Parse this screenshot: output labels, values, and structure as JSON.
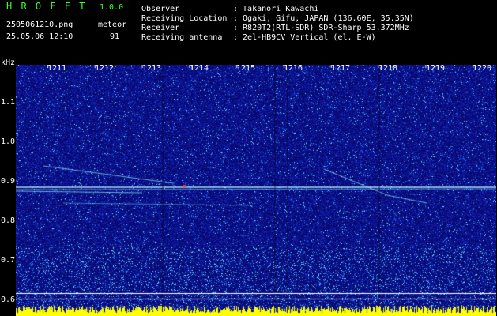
{
  "header": {
    "app_title": "H R O F F T",
    "version": "1.0.0",
    "filename": "2505061210.png",
    "datetime": "25.05.06 12:10",
    "meteor_label": "meteor",
    "meteor_count": "91",
    "observer_label": "Observer",
    "observer_value": ": Takanori Kawachi",
    "location_label": "Receiving Location",
    "location_value": ": Ogaki, Gifu, JAPAN (136.60E, 35.35N)",
    "receiver_label": "Receiver",
    "receiver_value": ": R820T2(RTL-SDR) SDR-Sharp 53.372MHz",
    "antenna_label": "Receiving antenna",
    "antenna_value": ": 2el-HB9CV Vertical (el. E-W)"
  },
  "spectrogram": {
    "y_unit": "kHz",
    "x_ticks": [
      "1211",
      "1212",
      "1213",
      "1214",
      "1215",
      "1216",
      "1217",
      "1218",
      "1219",
      "1220"
    ],
    "y_ticks": [
      "1.1",
      "1.0",
      "0.9",
      "0.8",
      "0.7",
      "0.6"
    ]
  },
  "colors": {
    "background": "#000000",
    "spectrum_base": "#1010a0",
    "title_green": "#33ff33",
    "text": "#ffffff",
    "level_bar": "#ffff00"
  }
}
